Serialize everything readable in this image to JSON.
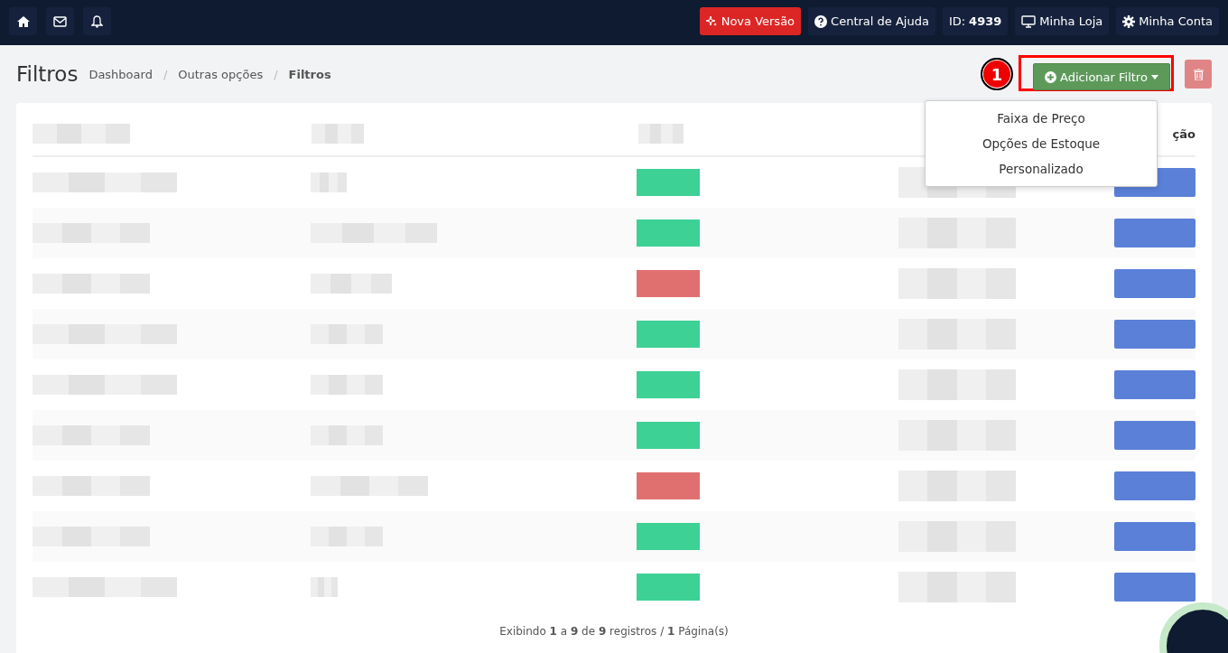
{
  "topbar": {
    "left_icons": [
      {
        "kind": "home"
      },
      {
        "kind": "mail"
      },
      {
        "kind": "bell"
      }
    ],
    "buttons": [
      {
        "label": "Nova Versão",
        "kind": "new"
      },
      {
        "label": "Central de Ajuda",
        "kind": "help"
      },
      {
        "label": "ID:",
        "value": "4939",
        "kind": "id"
      },
      {
        "label": "Minha Loja",
        "kind": "store"
      },
      {
        "label": "Minha Conta",
        "kind": "account"
      }
    ]
  },
  "page": {
    "title": "Filtros",
    "separator": "/",
    "breadcrumb": [
      {
        "label": "Dashboard",
        "current": false
      },
      {
        "label": "Outras opções",
        "current": false
      },
      {
        "label": "Filtros",
        "current": true
      }
    ]
  },
  "add_button": {
    "label": "Adicionar Filtro"
  },
  "callout": {
    "label": "1"
  },
  "dropdown": [
    "Faixa de Preço",
    "Opções de Estoque",
    "Personalizado"
  ],
  "table": {
    "last_column": "ção",
    "rows": [
      {
        "color": "#3dd195"
      },
      {
        "color": "#3dd195"
      },
      {
        "color": "#e07070"
      },
      {
        "color": "#3dd195"
      },
      {
        "color": "#3dd195"
      },
      {
        "color": "#3dd195"
      },
      {
        "color": "#e07070"
      },
      {
        "color": "#3dd195"
      },
      {
        "color": "#3dd195"
      }
    ]
  },
  "footer": "Exibindo **1** a **9** de **9** registros / **1** Página(s)"
}
